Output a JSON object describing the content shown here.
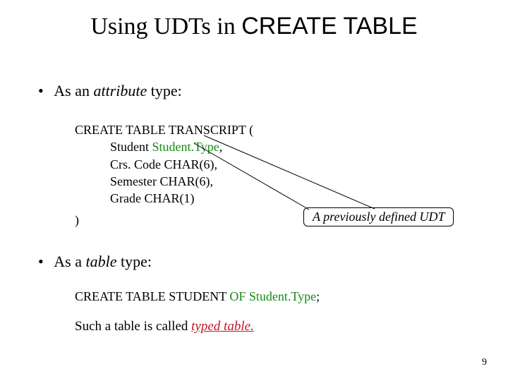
{
  "title": {
    "prefix": "Using UDTs in  ",
    "mono": "CREATE TABLE"
  },
  "bullets": {
    "b1_pre": "As an ",
    "b1_em": "attribute",
    "b1_post": " type:",
    "b2_pre": "As a ",
    "b2_em": "table",
    "b2_post": " type:"
  },
  "code1": {
    "l1": "CREATE  TABLE  TRANSCRIPT (",
    "l2a": "Student  ",
    "l2b": "Student.Type",
    "l2c": ",",
    "l3": "Crs. Code CHAR(6),",
    "l4": "Semester CHAR(6),",
    "l5": "Grade  CHAR(1)",
    "close": ")"
  },
  "callout": "A previously defined UDT",
  "code2": {
    "a": "CREATE TABLE  STUDENT  ",
    "b": "OF",
    "c": "  Student.Type",
    "d": ";"
  },
  "sentence": {
    "a": "Such a table is called  ",
    "b": "typed table.",
    "c": ""
  },
  "page": "9"
}
